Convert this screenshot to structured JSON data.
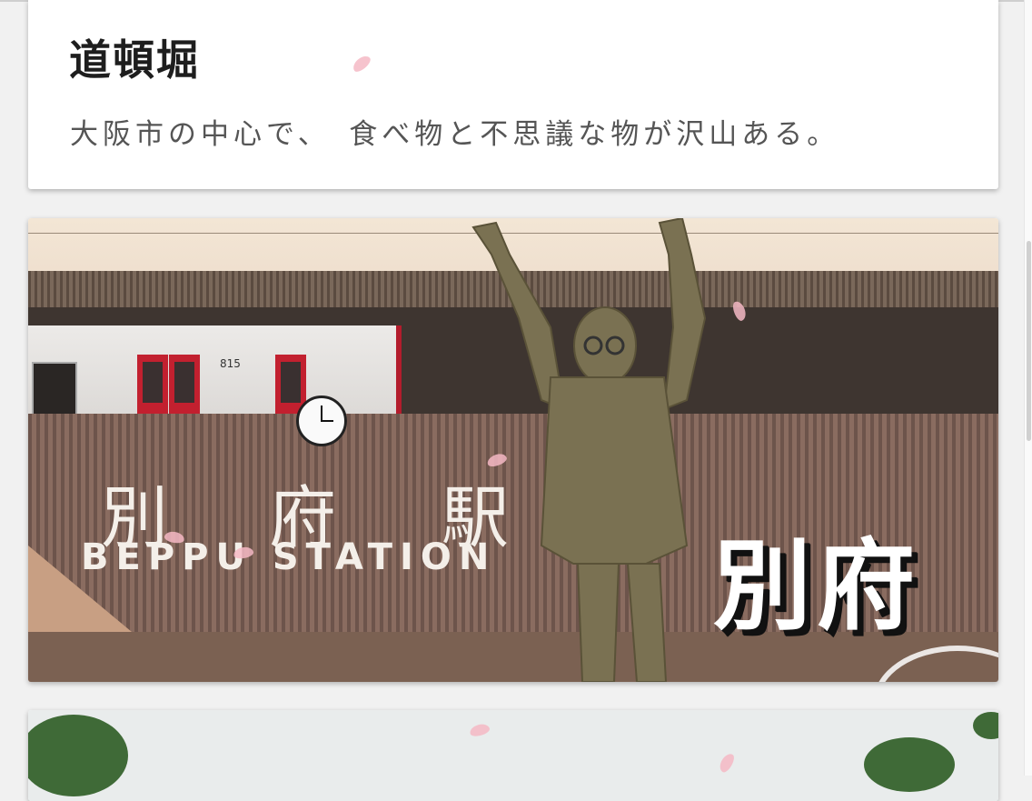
{
  "cards": [
    {
      "title": "道頓堀",
      "description": "大阪市の中心で、　食べ物と不思議な物が沢山ある。"
    },
    {
      "overlay_title": "別府",
      "sign_text_jp": [
        "別",
        "府",
        "駅"
      ],
      "sign_text_en": "BEPPU STATION",
      "train_number": "815"
    }
  ],
  "colors": {
    "page_bg": "#f1f1f1",
    "card_bg": "#ffffff",
    "title": "#1e1e1e",
    "description": "#555555",
    "petal": "#f5b8c4"
  }
}
